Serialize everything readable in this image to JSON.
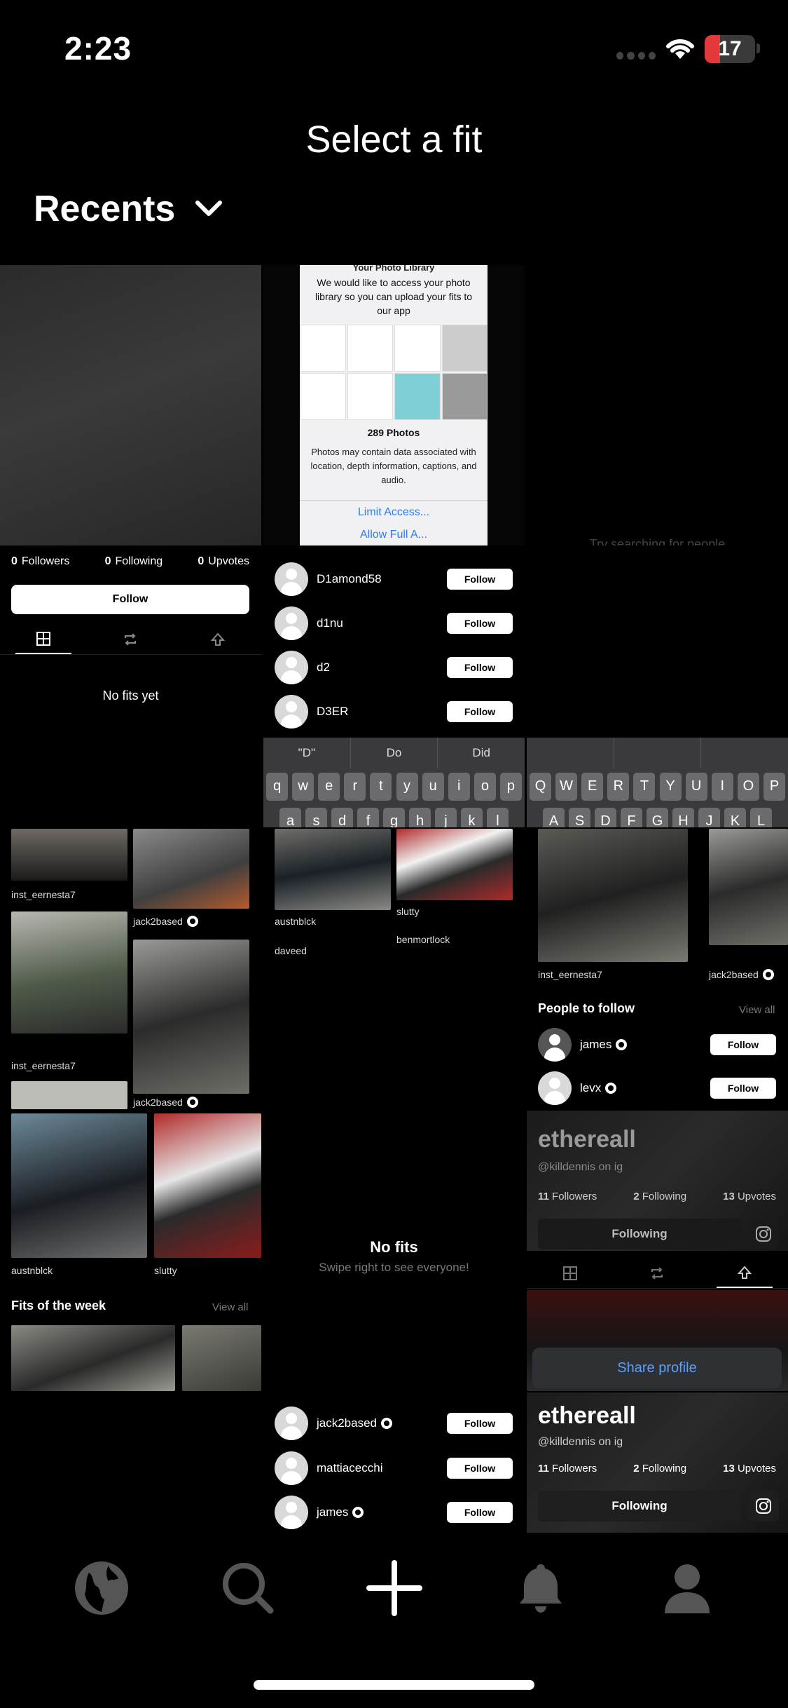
{
  "status": {
    "time": "2:23",
    "battery": "17"
  },
  "header": {
    "title": "Select a fit",
    "album": "Recents"
  },
  "profile_cell": {
    "followers": "0",
    "followers_label": "Followers",
    "following": "0",
    "following_label": "Following",
    "upvotes": "0",
    "upvotes_label": "Upvotes",
    "follow_label": "Follow",
    "empty": "No fits yet"
  },
  "permission_sheet": {
    "heading": "Your Photo Library",
    "desc": "We would like to access your photo library so you can upload your fits to our app",
    "count": "289 Photos",
    "note": "Photos may contain data associated with location, depth information, captions, and audio.",
    "limit": "Limit Access...",
    "allow": "Allow Full A..."
  },
  "search_hint": "Try searching for people",
  "search_results": [
    {
      "name": "D1amond58",
      "follow": "Follow"
    },
    {
      "name": "d1nu",
      "follow": "Follow"
    },
    {
      "name": "d2",
      "follow": "Follow"
    },
    {
      "name": "D3ER",
      "follow": "Follow"
    }
  ],
  "keyboard_lower": {
    "suggestions": [
      "\"D\"",
      "Do",
      "Did"
    ],
    "row1": [
      "q",
      "w",
      "e",
      "r",
      "t",
      "y",
      "u",
      "i",
      "o",
      "p"
    ],
    "row2": [
      "a",
      "s",
      "d",
      "f",
      "g",
      "h",
      "j",
      "k",
      "l"
    ]
  },
  "keyboard_upper": {
    "suggestions": [
      "",
      "",
      ""
    ],
    "row1": [
      "Q",
      "W",
      "E",
      "R",
      "T",
      "Y",
      "U",
      "I",
      "O",
      "P"
    ],
    "row2": [
      "A",
      "S",
      "D",
      "F",
      "G",
      "H",
      "J",
      "K",
      "L"
    ]
  },
  "feed_a": {
    "u1": "inst_eernesta7",
    "u2": "jack2based",
    "u3": "inst_eernesta7",
    "u4": "jack2based",
    "u5": "austnblck",
    "u6": "slutty"
  },
  "feed_b": {
    "u1": "austnblck",
    "u2": "slutty",
    "u3": "daveed",
    "u4": "benmortlock"
  },
  "feed_c": {
    "u1": "inst_eernesta7",
    "u2": "jack2based",
    "people_title": "People to follow",
    "view_all": "View all",
    "people": [
      {
        "name": "james",
        "follow": "Follow"
      },
      {
        "name": "levx",
        "follow": "Follow"
      }
    ]
  },
  "fits_week": {
    "title": "Fits of the week",
    "view_all": "View all"
  },
  "empty_feed": {
    "title": "No fits",
    "subtitle": "Swipe right to see everyone!"
  },
  "ethereall": {
    "name": "ethereall",
    "handle": "@killdennis on ig",
    "followers": "11",
    "followers_label": "Followers",
    "following": "2",
    "following_label": "Following",
    "upvotes": "13",
    "upvotes_label": "Upvotes",
    "button": "Following",
    "share": "Share profile"
  },
  "bottom_list": [
    {
      "name": "jack2based",
      "verified": true,
      "follow": "Follow"
    },
    {
      "name": "mattiacecchi",
      "verified": false,
      "follow": "Follow"
    },
    {
      "name": "james",
      "verified": true,
      "follow": "Follow"
    }
  ]
}
